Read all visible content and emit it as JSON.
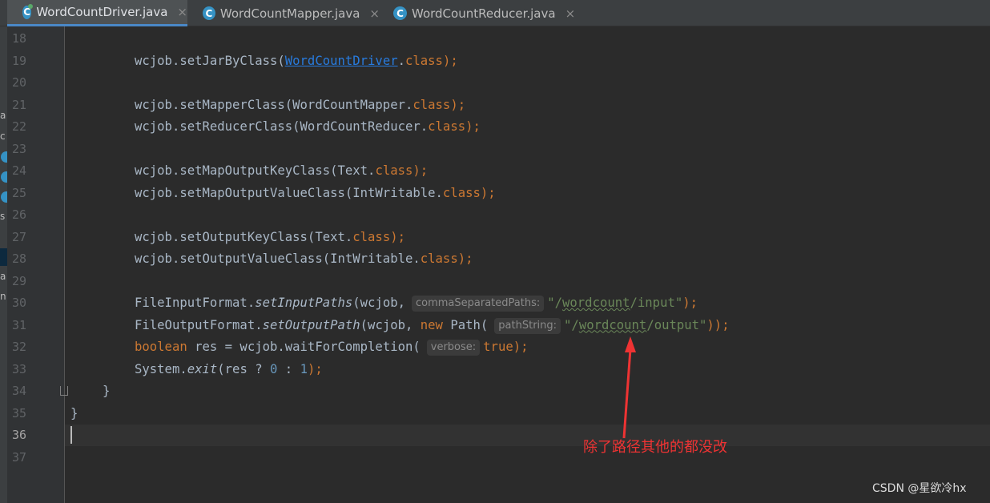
{
  "tabs": [
    {
      "label": "WordCountDriver.java",
      "active": true
    },
    {
      "label": "WordCountMapper.java",
      "active": false
    },
    {
      "label": "WordCountReducer.java",
      "active": false
    }
  ],
  "tab_icon_letter": "C",
  "tab_close_glyph": "×",
  "line_numbers": [
    "18",
    "19",
    "20",
    "21",
    "22",
    "23",
    "24",
    "25",
    "26",
    "27",
    "28",
    "29",
    "30",
    "31",
    "32",
    "33",
    "34",
    "35",
    "36",
    "37"
  ],
  "current_line": "36",
  "code": {
    "l19": {
      "a": "wcjob.setJarByClass(",
      "link": "WordCountDriver",
      "dot": ".",
      "kw": "class",
      "end": ");"
    },
    "l21": {
      "a": "wcjob.setMapperClass(WordCountMapper.",
      "kw": "class",
      "end": ");"
    },
    "l22": {
      "a": "wcjob.setReducerClass(WordCountReducer.",
      "kw": "class",
      "end": ");"
    },
    "l24": {
      "a": "wcjob.setMapOutputKeyClass(Text.",
      "kw": "class",
      "end": ");"
    },
    "l25": {
      "a": "wcjob.setMapOutputValueClass(IntWritable.",
      "kw": "class",
      "end": ");"
    },
    "l27": {
      "a": "wcjob.setOutputKeyClass(Text.",
      "kw": "class",
      "end": ");"
    },
    "l28": {
      "a": "wcjob.setOutputValueClass(IntWritable.",
      "kw": "class",
      "end": ");"
    },
    "l30": {
      "a": "FileInputFormat.",
      "method": "setInputPaths",
      "b": "(wcjob,",
      "hint": "commaSeparatedPaths:",
      "s1": "\"/",
      "sq": "wordcount",
      "s2": "/input\"",
      "end": ");"
    },
    "l31": {
      "a": "FileOutputFormat.",
      "method": "setOutputPath",
      "b": "(wcjob, ",
      "kw": "new",
      "c": " Path(",
      "hint": "pathString:",
      "s1": "\"/",
      "sq": "wordcount",
      "s2": "/output\"",
      "end": "));"
    },
    "l32": {
      "kw": "boolean",
      "a": " res = wcjob.waitForCompletion(",
      "hint": "verbose:",
      "kw2": "true",
      "end": ");"
    },
    "l33": {
      "a": "System.",
      "method": "exit",
      "b": "(res ? ",
      "n0": "0",
      "c": " : ",
      "n1": "1",
      "end": ");"
    },
    "l34": "}",
    "l35": "}"
  },
  "annotation": "除了路径其他的都没改",
  "watermark": "CSDN @星欲冷hx",
  "side_fragments": [
    "a",
    "c",
    "s",
    "a",
    "n"
  ],
  "colors": {
    "background": "#2b2b2b",
    "keyword": "#cc7832",
    "string": "#6a8759",
    "number": "#6897bb",
    "annotation": "#ee3333"
  }
}
